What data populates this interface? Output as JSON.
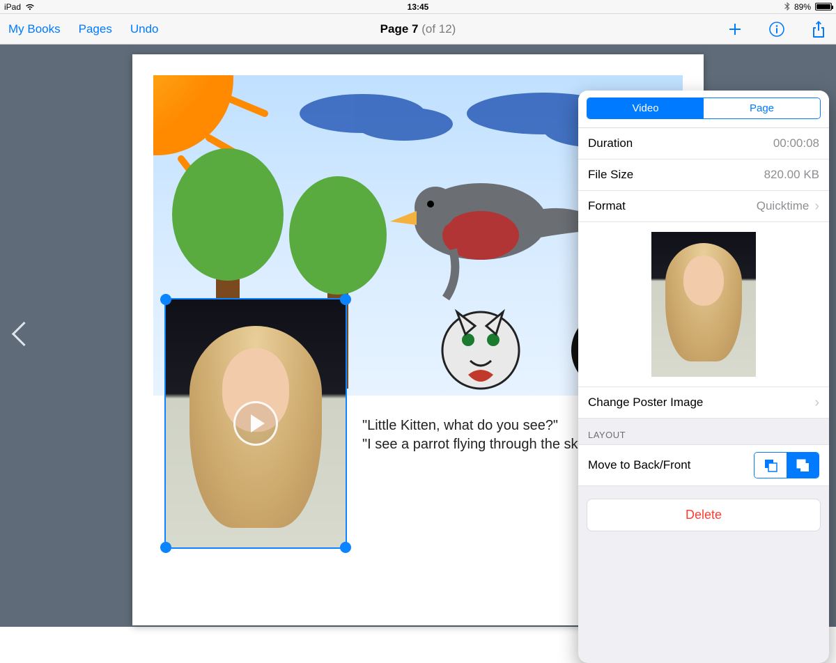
{
  "status": {
    "device": "iPad",
    "time": "13:45",
    "battery_pct": "89%",
    "battery_fill": 89
  },
  "toolbar": {
    "my_books": "My Books",
    "pages": "Pages",
    "undo": "Undo",
    "title_bold": "Page 7",
    "title_rest": " (of 12)"
  },
  "story": {
    "line1": "\"Little Kitten, what do you see?\"",
    "line2": "\"I see a parrot flying through the sky.\""
  },
  "popover": {
    "tabs": {
      "video": "Video",
      "page": "Page"
    },
    "rows": {
      "duration_label": "Duration",
      "duration_value": "00:00:08",
      "filesize_label": "File Size",
      "filesize_value": "820.00 KB",
      "format_label": "Format",
      "format_value": "Quicktime"
    },
    "change_poster": "Change Poster Image",
    "layout_header": "LAYOUT",
    "move_label": "Move to Back/Front",
    "delete": "Delete"
  }
}
